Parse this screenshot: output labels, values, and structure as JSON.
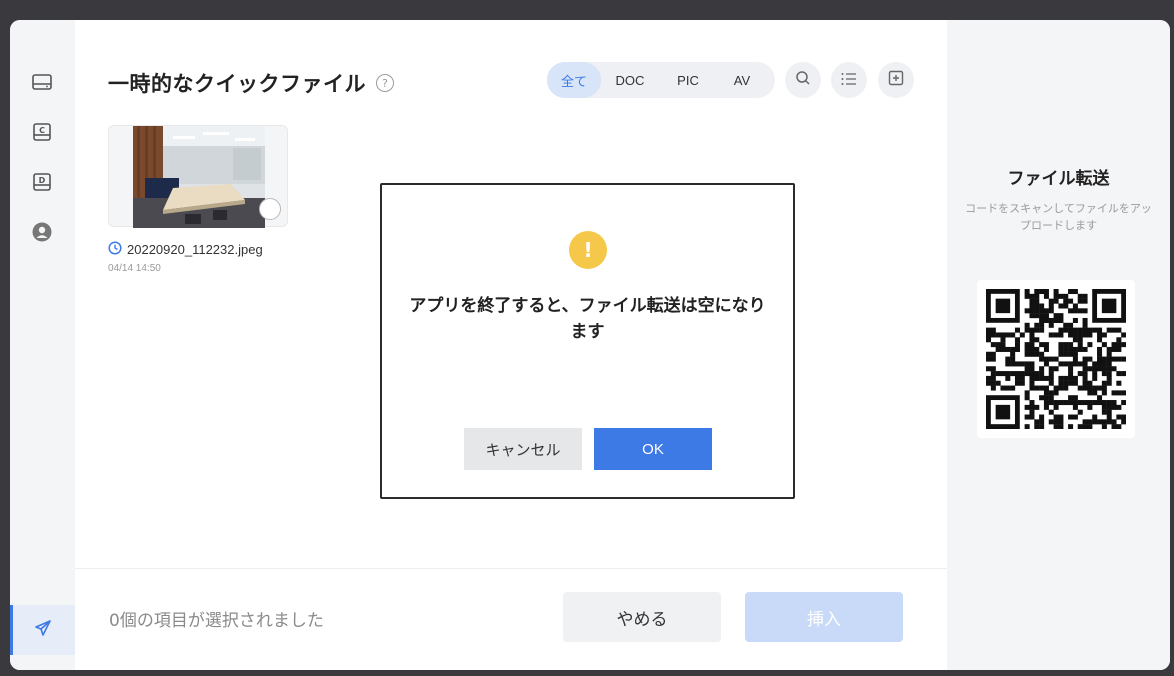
{
  "header": {
    "title": "一時的なクイックファイル",
    "help_icon": "question-circle-icon"
  },
  "filters": [
    {
      "label": "全て",
      "active": true
    },
    {
      "label": "DOC",
      "active": false
    },
    {
      "label": "PIC",
      "active": false
    },
    {
      "label": "AV",
      "active": false
    }
  ],
  "toolbar_icons": [
    "search-icon",
    "list-icon",
    "add-folder-icon"
  ],
  "files": [
    {
      "name": "20220920_112232.jpeg",
      "date": "04/14 14:50",
      "icon": "clock-icon"
    }
  ],
  "footer": {
    "status": "0個の項目が選択されました",
    "cancel_label": "やめる",
    "insert_label": "挿入"
  },
  "side": {
    "title": "ファイル転送",
    "description": "コードをスキャンしてファイルをアップロードします"
  },
  "dialog": {
    "icon": "warning-icon",
    "icon_text": "!",
    "message": "アプリを終了すると、ファイル転送は空になります",
    "cancel_label": "キャンセル",
    "ok_label": "OK"
  },
  "rail": {
    "icons": [
      "drive-icon",
      "disk-c-icon",
      "disk-d-icon",
      "user-icon",
      "send-icon"
    ]
  },
  "colors": {
    "accent": "#3d7ae5",
    "accent_light": "#d8e4f7",
    "warning": "#f5c84a",
    "insert_disabled": "#c8daf8"
  }
}
